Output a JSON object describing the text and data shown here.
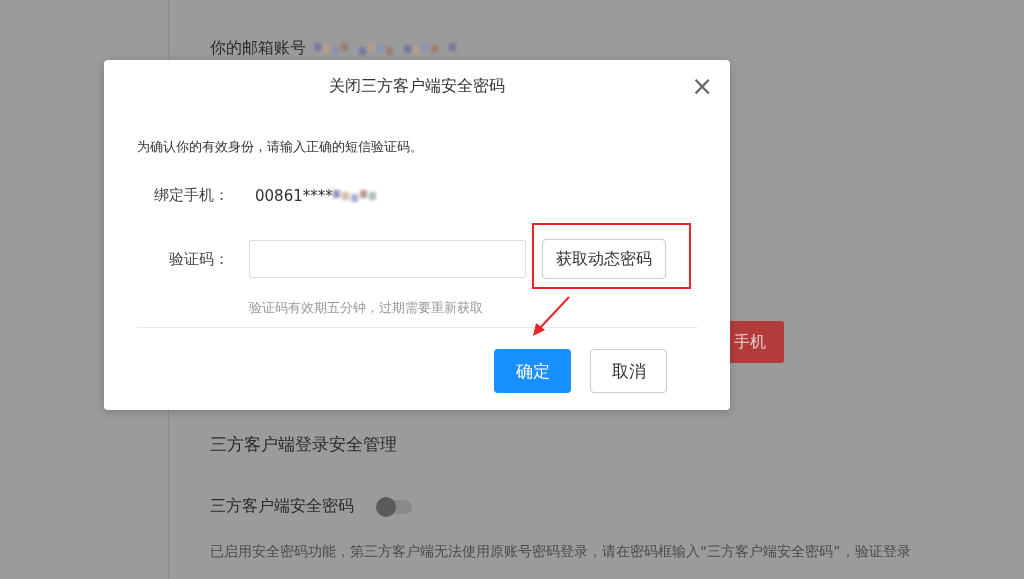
{
  "background": {
    "email_label": "你的邮箱账号",
    "phone_button": "手机",
    "section_title": "三方客户端登录安全管理",
    "toggle": {
      "label": "三方客户端安全密码",
      "on": false
    },
    "description": "已启用安全密码功能，第三方客户端无法使用原账号密码登录，请在密码框输入“三方客户端安全密码”，验证登录"
  },
  "dialog": {
    "title": "关闭三方客户端安全密码",
    "close": "×",
    "instruction": "为确认你的有效身份，请输入正确的短信验证码。",
    "phone_label": "绑定手机：",
    "phone_value": "00861****",
    "code_label": "验证码：",
    "get_code_button": "获取动态密码",
    "hint": "验证码有效期五分钟，过期需要重新获取",
    "buttons": [
      {
        "label": "确定",
        "kind": "primary"
      },
      {
        "label": "取消",
        "kind": "default"
      }
    ]
  }
}
